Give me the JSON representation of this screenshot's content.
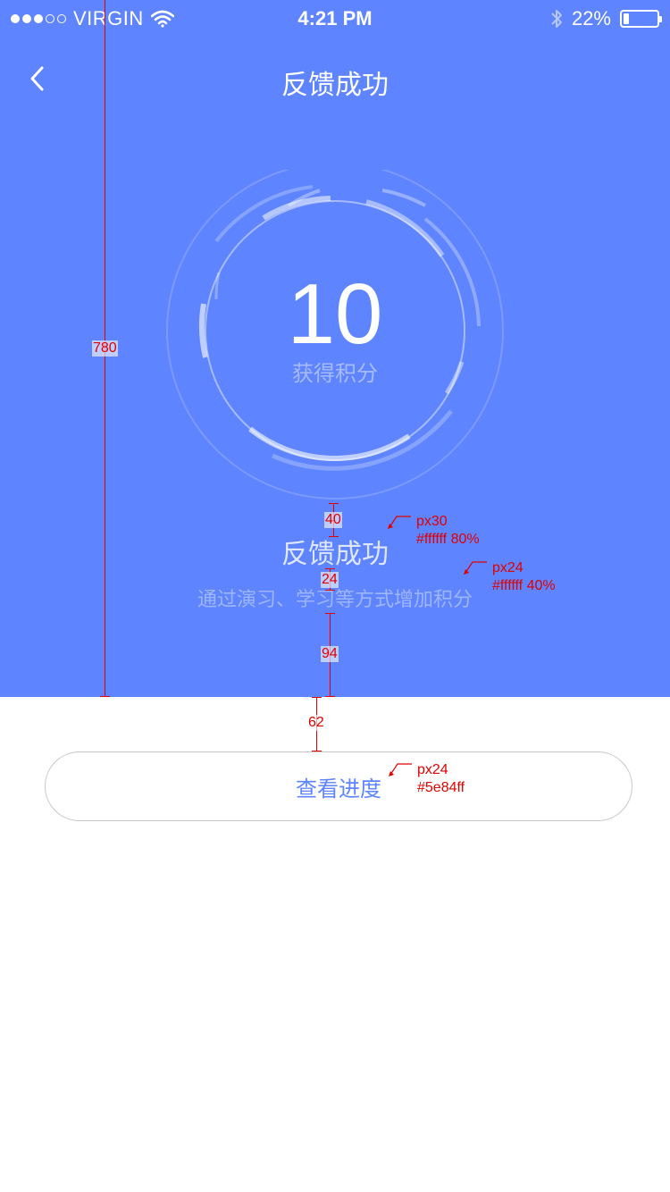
{
  "status_bar": {
    "carrier": "VIRGIN",
    "time": "4:21 PM",
    "battery": "22%",
    "icons": [
      "signal-icon",
      "wifi-icon",
      "bluetooth-icon",
      "battery-icon"
    ]
  },
  "nav": {
    "title": "反馈成功",
    "back_icon": "chevron-left-icon"
  },
  "result": {
    "score": "10",
    "score_label": "获得积分",
    "title": "反馈成功",
    "subtitle": "通过演习、学习等方式增加积分"
  },
  "action": {
    "view_progress_label": "查看进度"
  },
  "annotations": {
    "h780": "780",
    "h40": "40",
    "h24": "24",
    "h94": "94",
    "h62": "62",
    "note1_size": "px30",
    "note1_color": "#ffffff 80%",
    "note2_size": "px24",
    "note2_color": "#ffffff 40%",
    "note3_size": "px24",
    "note3_color": "#5e84ff"
  },
  "colors": {
    "brand": "#5e84ff",
    "annotation": "#e00000",
    "background": "#ffffff"
  }
}
